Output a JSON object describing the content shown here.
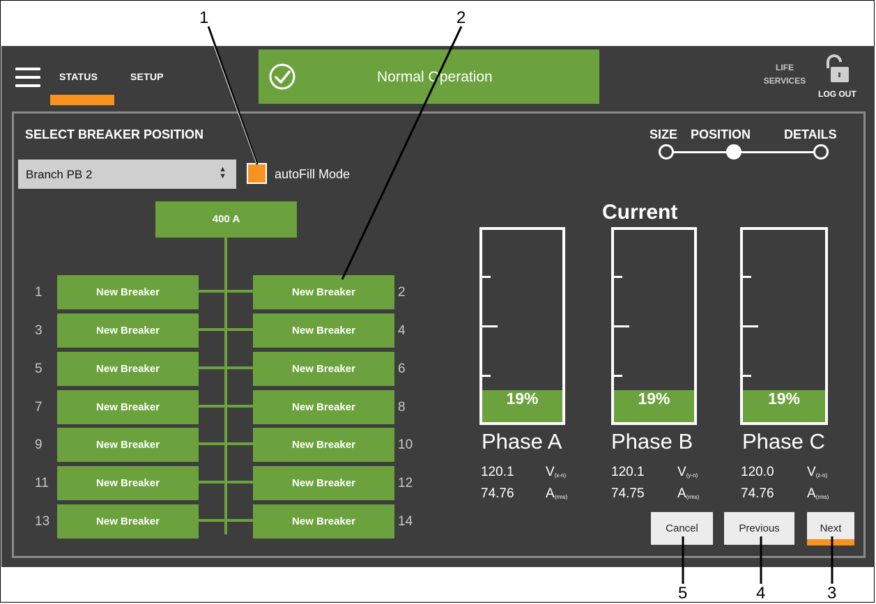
{
  "header": {
    "tabs": [
      {
        "label": "STATUS",
        "active": true
      },
      {
        "label": "SETUP",
        "active": false
      }
    ],
    "status_banner": "Normal Operation",
    "life_services": "LIFE SERVICES",
    "logout": "LOG OUT"
  },
  "panel": {
    "title": "SELECT BREAKER POSITION",
    "dropdown_value": "Branch PB 2",
    "autofill_label": "autoFill Mode",
    "steps": [
      "SIZE",
      "POSITION",
      "DETAILS"
    ],
    "active_step": "POSITION",
    "main_breaker": "400 A",
    "breakers": {
      "left": [
        {
          "num": "1",
          "label": "New Breaker"
        },
        {
          "num": "3",
          "label": "New Breaker"
        },
        {
          "num": "5",
          "label": "New Breaker"
        },
        {
          "num": "7",
          "label": "New Breaker"
        },
        {
          "num": "9",
          "label": "New Breaker"
        },
        {
          "num": "11",
          "label": "New Breaker"
        },
        {
          "num": "13",
          "label": "New Breaker"
        }
      ],
      "right": [
        {
          "num": "2",
          "label": "New Breaker"
        },
        {
          "num": "4",
          "label": "New Breaker"
        },
        {
          "num": "6",
          "label": "New Breaker"
        },
        {
          "num": "8",
          "label": "New Breaker"
        },
        {
          "num": "10",
          "label": "New Breaker"
        },
        {
          "num": "12",
          "label": "New Breaker"
        },
        {
          "num": "14",
          "label": "New Breaker"
        }
      ]
    },
    "current_title": "Current",
    "phases": [
      {
        "name": "Phase A",
        "percent_label": "19%",
        "fraction": 0.19,
        "voltage": "120.1",
        "v_unit": "V",
        "v_sub": "(x-n)",
        "amps": "74.76",
        "a_unit": "A",
        "a_sub": "(rms)"
      },
      {
        "name": "Phase B",
        "percent_label": "19%",
        "fraction": 0.19,
        "voltage": "120.1",
        "v_unit": "V",
        "v_sub": "(y-n)",
        "amps": "74.75",
        "a_unit": "A",
        "a_sub": "(rms)"
      },
      {
        "name": "Phase C",
        "percent_label": "19%",
        "fraction": 0.19,
        "voltage": "120.0",
        "v_unit": "V",
        "v_sub": "(z-n)",
        "amps": "74.76",
        "a_unit": "A",
        "a_sub": "(rms)"
      }
    ],
    "buttons": {
      "cancel": "Cancel",
      "previous": "Previous",
      "next": "Next"
    }
  },
  "callouts": [
    "1",
    "2",
    "3",
    "4",
    "5"
  ],
  "colors": {
    "accent": "#f7931e",
    "green": "#6ba23d",
    "background": "#3d3d3d"
  }
}
